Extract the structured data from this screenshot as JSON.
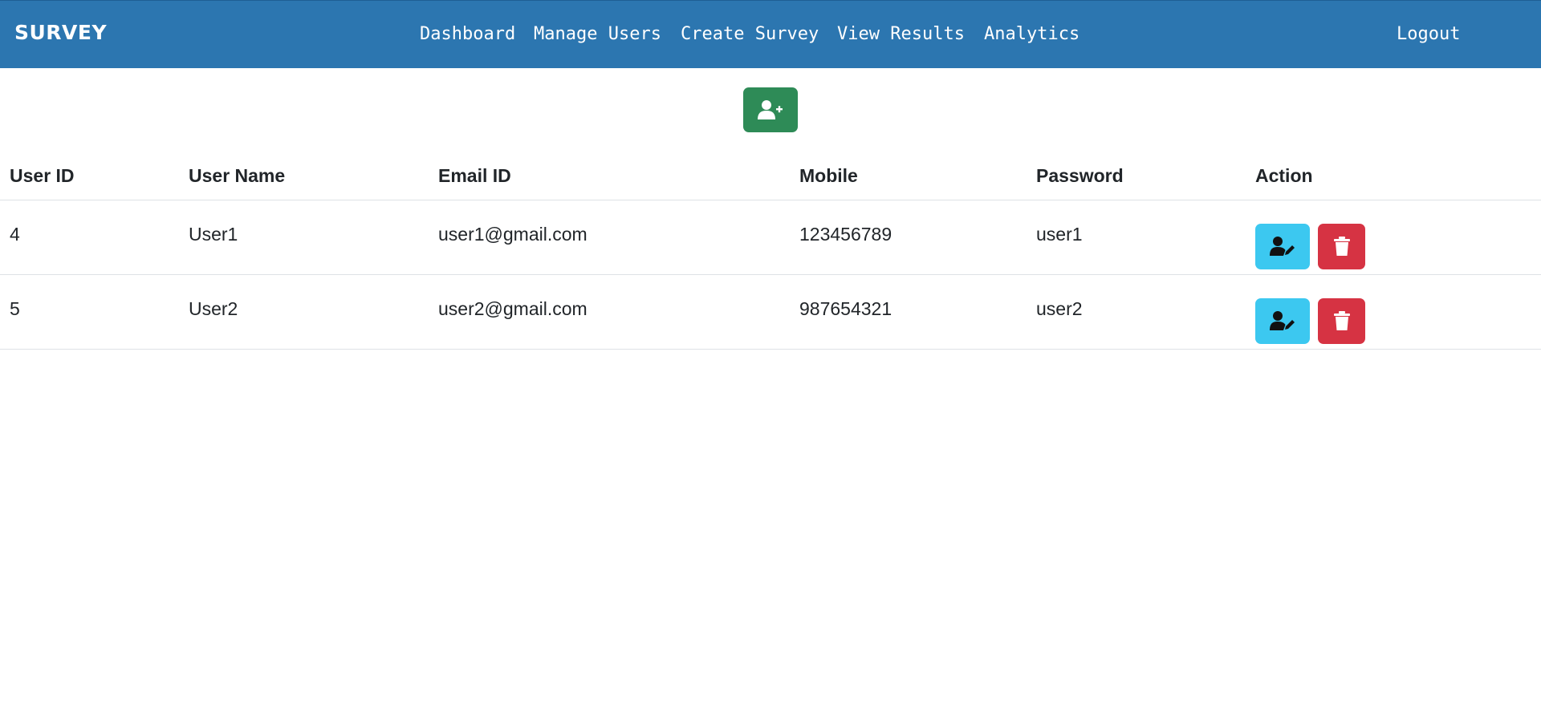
{
  "navbar": {
    "brand": "SURVEY",
    "links": [
      {
        "label": "Dashboard"
      },
      {
        "label": "Manage Users"
      },
      {
        "label": "Create Survey"
      },
      {
        "label": "View Results"
      },
      {
        "label": "Analytics"
      }
    ],
    "logout": "Logout"
  },
  "add_button": {
    "icon": "user-plus-icon"
  },
  "table": {
    "headers": [
      "User ID",
      "User Name",
      "Email ID",
      "Mobile",
      "Password",
      "Action"
    ],
    "rows": [
      {
        "id": "4",
        "name": "User1",
        "email": "user1@gmail.com",
        "mobile": "123456789",
        "password": "user1"
      },
      {
        "id": "5",
        "name": "User2",
        "email": "user2@gmail.com",
        "mobile": "987654321",
        "password": "user2"
      }
    ]
  },
  "colors": {
    "navbar": "#2c76b0",
    "add_button": "#2e8b57",
    "edit_button": "#3cc8f0",
    "delete_button": "#d63343"
  }
}
